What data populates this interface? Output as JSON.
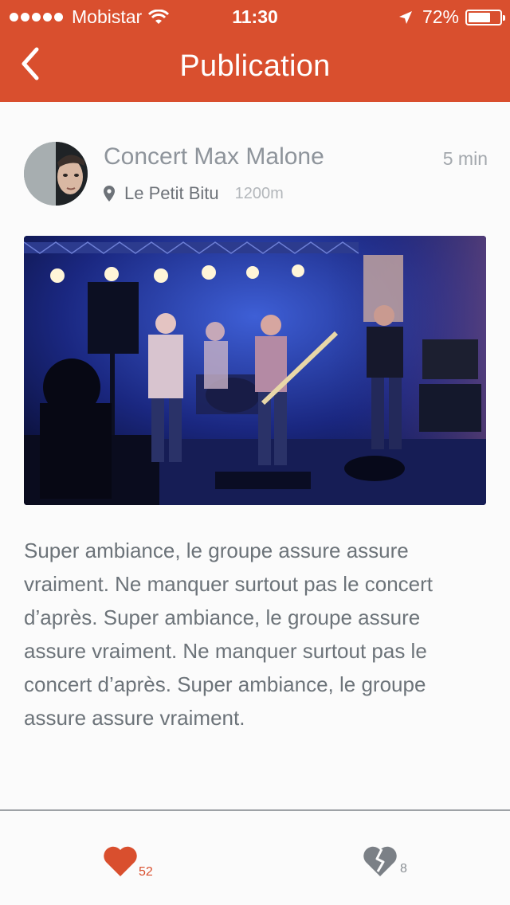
{
  "status_bar": {
    "carrier": "Mobistar",
    "time": "11:30",
    "battery_percent": "72%",
    "battery_level": 0.72
  },
  "nav": {
    "title": "Publication"
  },
  "post": {
    "title": "Concert Max Malone",
    "time_ago": "5 min",
    "place": "Le Petit Bitu",
    "distance": "1200m",
    "description": "Super ambiance, le groupe assure assure vraiment. Ne manquer surtout pas le concert d’après. Super ambiance, le groupe assure assure vraiment. Ne manquer surtout pas le concert d’après. Super ambiance, le groupe assure assure vraiment."
  },
  "actions": {
    "likes": "52",
    "dislikes": "8"
  },
  "colors": {
    "accent": "#d94f2e",
    "text_muted": "#8e949b"
  },
  "icons": [
    "back-chevron-icon",
    "map-pin-icon",
    "heart-icon",
    "broken-heart-icon",
    "wifi-icon",
    "location-arrow-icon",
    "battery-icon"
  ]
}
